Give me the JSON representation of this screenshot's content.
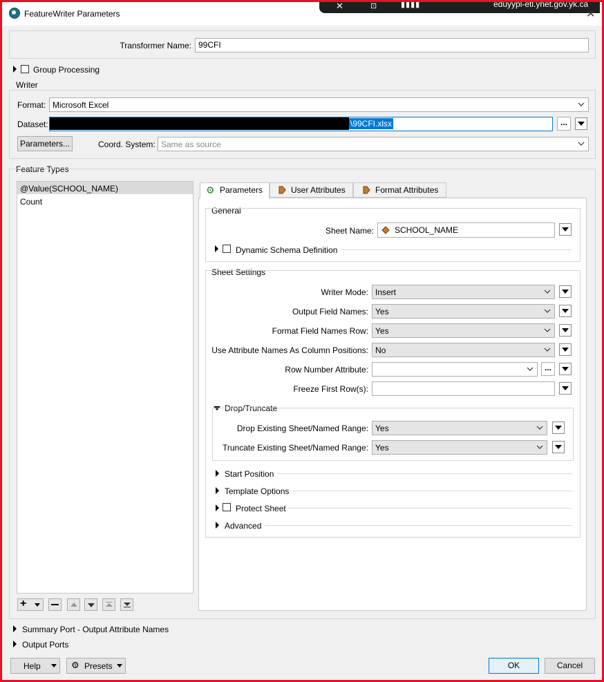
{
  "window": {
    "title": "FeatureWriter Parameters",
    "overlay_text": "eduyypl-etl.ynet.gov.yk.ca"
  },
  "transformer": {
    "label": "Transformer Name:",
    "value": "99CFI"
  },
  "group_processing": {
    "label": "Group Processing"
  },
  "writer": {
    "heading": "Writer",
    "format_label": "Format:",
    "format_value": "Microsoft Excel",
    "dataset_label": "Dataset:",
    "dataset_suffix": "\\99CFI.xlsx",
    "parameters_button": "Parameters...",
    "coord_label": "Coord. System:",
    "coord_placeholder": "Same as source"
  },
  "feature_types": {
    "heading": "Feature Types",
    "items": [
      {
        "label": "@Value(SCHOOL_NAME)",
        "selected": true
      },
      {
        "label": "Count",
        "selected": false
      }
    ]
  },
  "tabs": [
    {
      "label": "Parameters",
      "icon": "gear-icon"
    },
    {
      "label": "User Attributes",
      "icon": "attribute-icon"
    },
    {
      "label": "Format Attributes",
      "icon": "attribute-icon"
    }
  ],
  "general": {
    "heading": "General",
    "sheet_name_label": "Sheet Name:",
    "sheet_name_value": "SCHOOL_NAME",
    "dynamic_schema_label": "Dynamic Schema Definition"
  },
  "sheet_settings": {
    "heading": "Sheet Settings",
    "rows": [
      {
        "label": "Writer Mode:",
        "value": "Insert"
      },
      {
        "label": "Output Field Names:",
        "value": "Yes"
      },
      {
        "label": "Format Field Names Row:",
        "value": "Yes"
      },
      {
        "label": "Use Attribute Names As Column Positions:",
        "value": "No"
      }
    ],
    "row_number_label": "Row Number Attribute:",
    "row_number_value": "",
    "freeze_label": "Freeze First Row(s):",
    "freeze_value": ""
  },
  "drop_truncate": {
    "heading": "Drop/Truncate",
    "drop_label": "Drop Existing Sheet/Named Range:",
    "drop_value": "Yes",
    "truncate_label": "Truncate Existing Sheet/Named Range:",
    "truncate_value": "Yes"
  },
  "collapsed_sections": {
    "start_position": "Start Position",
    "template_options": "Template Options",
    "protect_sheet": "Protect Sheet",
    "advanced": "Advanced"
  },
  "bottom_sections": {
    "summary_port": "Summary Port - Output Attribute Names",
    "output_ports": "Output Ports"
  },
  "footer": {
    "help": "Help",
    "presets": "Presets",
    "ok": "OK",
    "cancel": "Cancel"
  },
  "colors": {
    "accent": "#0078d7",
    "frame": "#e81123"
  }
}
